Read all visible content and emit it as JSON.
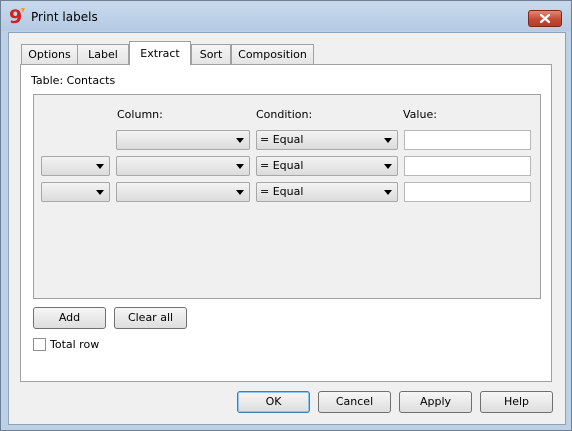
{
  "window": {
    "title": "Print labels",
    "close_tooltip": "",
    "accent": "#c44a35"
  },
  "tabs": [
    {
      "label": "Options",
      "active": false
    },
    {
      "label": "Label",
      "active": false
    },
    {
      "label": "Extract",
      "active": true
    },
    {
      "label": "Sort",
      "active": false
    },
    {
      "label": "Composition",
      "active": false
    }
  ],
  "extract": {
    "table_label": "Table: Contacts",
    "headers": {
      "column": "Column:",
      "condition": "Condition:",
      "value": "Value:"
    },
    "rows": [
      {
        "logic": null,
        "column": "",
        "condition": "= Equal",
        "value": ""
      },
      {
        "logic": "",
        "column": "",
        "condition": "= Equal",
        "value": ""
      },
      {
        "logic": "",
        "column": "",
        "condition": "= Equal",
        "value": ""
      }
    ],
    "add_label": "Add",
    "clear_label": "Clear all",
    "total_row_label": "Total row",
    "total_row_checked": false
  },
  "footer": {
    "ok": "OK",
    "cancel": "Cancel",
    "apply": "Apply",
    "help": "Help"
  }
}
